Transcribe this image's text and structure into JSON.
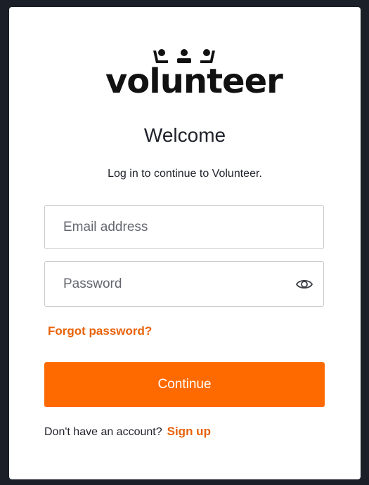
{
  "logo": {
    "text": "volunteer"
  },
  "header": {
    "title": "Welcome",
    "subtitle": "Log in to continue to Volunteer."
  },
  "form": {
    "email_placeholder": "Email address",
    "password_placeholder": "Password",
    "forgot_password_label": "Forgot password?",
    "continue_label": "Continue"
  },
  "footer": {
    "prompt": "Don't have an account?",
    "signup_label": "Sign up"
  },
  "icons": {
    "password_toggle": "eye-icon",
    "logo_mark": "three-people-icon"
  },
  "colors": {
    "accent": "#ff6a00",
    "link": "#e8620a",
    "background": "#1b1f27",
    "card": "#ffffff"
  }
}
